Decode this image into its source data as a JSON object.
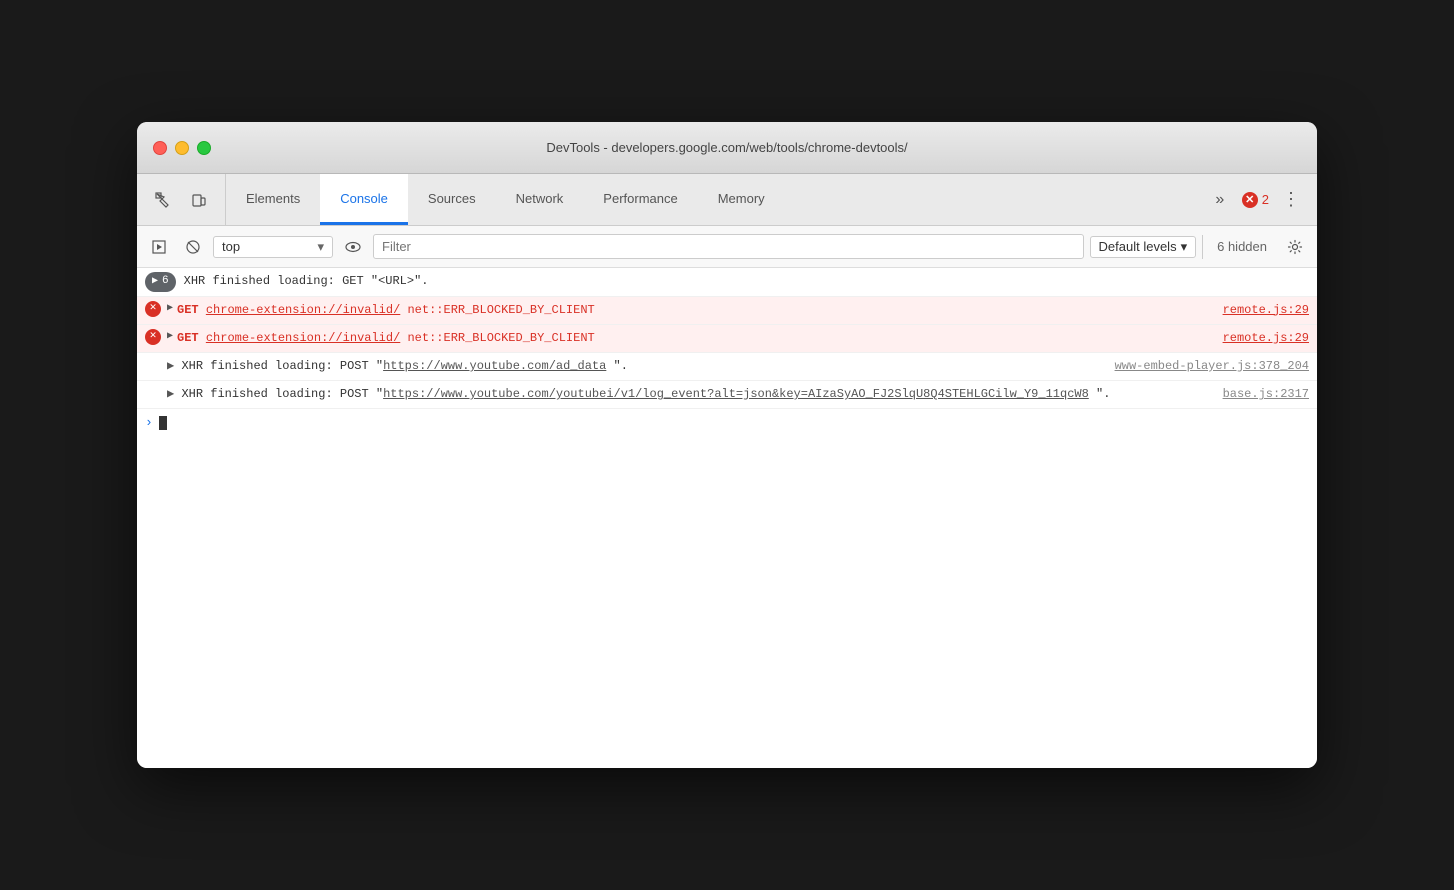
{
  "window": {
    "title": "DevTools - developers.google.com/web/tools/chrome-devtools/"
  },
  "traffic_lights": {
    "close_label": "close",
    "minimize_label": "minimize",
    "maximize_label": "maximize"
  },
  "tabs": [
    {
      "id": "elements",
      "label": "Elements",
      "active": false
    },
    {
      "id": "console",
      "label": "Console",
      "active": true
    },
    {
      "id": "sources",
      "label": "Sources",
      "active": false
    },
    {
      "id": "network",
      "label": "Network",
      "active": false
    },
    {
      "id": "performance",
      "label": "Performance",
      "active": false
    },
    {
      "id": "memory",
      "label": "Memory",
      "active": false
    }
  ],
  "tabs_right": {
    "more_label": "»",
    "error_count": "2",
    "more_options_label": "⋮"
  },
  "console_toolbar": {
    "execute_label": "▶",
    "clear_label": "🚫",
    "context_value": "top",
    "context_arrow": "▾",
    "eye_icon": "👁",
    "filter_placeholder": "Filter",
    "levels_label": "Default levels",
    "levels_arrow": "▾",
    "hidden_label": "6 hidden",
    "settings_label": "⚙"
  },
  "console_entries": [
    {
      "type": "xhr",
      "badge_count": "6",
      "message": "XHR finished loading: GET \"<URL>\"."
    },
    {
      "type": "error",
      "method": "GET",
      "url": "chrome-extension://invalid/",
      "error": "net::ERR_BLOCKED_BY_CLIENT",
      "file": "remote.js:29"
    },
    {
      "type": "error",
      "method": "GET",
      "url": "chrome-extension://invalid/",
      "error": "net::ERR_BLOCKED_BY_CLIENT",
      "file": "remote.js:29"
    },
    {
      "type": "xhr_post",
      "message_prefix": "XHR finished loading: POST \"",
      "url": "https://www.youtube.com/ad_data",
      "message_suffix": "\".",
      "file": "www-embed-player.js:378_204"
    },
    {
      "type": "xhr_post2",
      "message_prefix": "XHR finished loading: POST \"",
      "url": "https://www.youtube.com/youtubei/v1/log_event?alt=json&key=AIzaSyAO_FJ2SlqU8Q4STEHLGCilw_Y9_11qcW8",
      "message_suffix": "\".",
      "file": "base.js:2317"
    }
  ]
}
